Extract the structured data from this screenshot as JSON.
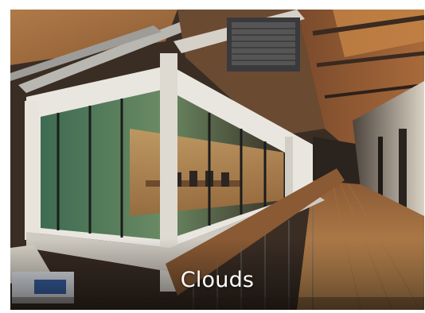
{
  "card": {
    "caption": "Clouds",
    "image_subject": "office-interior-photo"
  }
}
